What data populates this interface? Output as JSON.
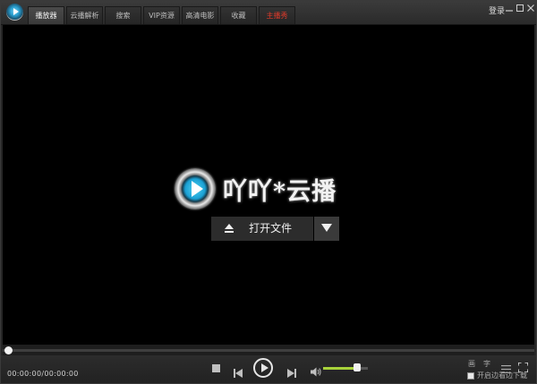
{
  "app": {
    "logo_icon": "app-logo-icon"
  },
  "tabs": [
    {
      "label": "播放器",
      "active": true
    },
    {
      "label": "云播解析"
    },
    {
      "label": "搜索"
    },
    {
      "label": "VIP资源"
    },
    {
      "label": "高清电影"
    },
    {
      "label": "收藏"
    },
    {
      "label": "主播秀",
      "color": "#e03a2a"
    }
  ],
  "header": {
    "login_label": "登录",
    "window_controls": [
      "minimize-icon",
      "maximize-icon",
      "close-icon"
    ]
  },
  "player": {
    "brand_text": "吖吖*云播",
    "open_file_label": "打开文件",
    "eject_icon": "eject-icon",
    "dropdown_icon": "triangle-down-icon"
  },
  "progress": {
    "value": 0
  },
  "controls": {
    "time_text": "00:00:00/00:00:00",
    "volume_level": 0.75,
    "accent_color": "#a8d23a",
    "hq_label": "画",
    "subtitle_label": "字",
    "download_label": "开启边看边下载",
    "download_checked": false
  }
}
